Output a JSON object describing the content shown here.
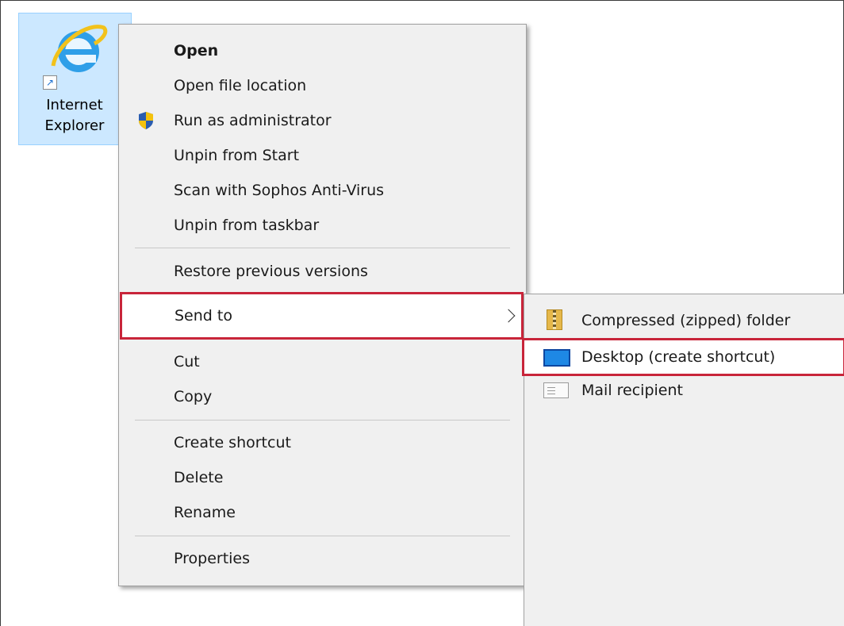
{
  "desktop_icon": {
    "label_line1": "Internet",
    "label_line2": "Explorer",
    "icon": "internet-explorer-icon"
  },
  "context_menu": {
    "items": [
      {
        "label": "Open"
      },
      {
        "label": "Open file location"
      },
      {
        "label": "Run as administrator",
        "icon": "shield-icon"
      },
      {
        "label": "Unpin from Start"
      },
      {
        "label": "Scan with Sophos Anti-Virus"
      },
      {
        "label": "Unpin from taskbar"
      },
      {
        "label": "Restore previous versions"
      },
      {
        "label": "Send to",
        "icon": "chevron-right-icon"
      },
      {
        "label": "Cut"
      },
      {
        "label": "Copy"
      },
      {
        "label": "Create shortcut"
      },
      {
        "label": "Delete"
      },
      {
        "label": "Rename"
      },
      {
        "label": "Properties"
      }
    ]
  },
  "send_to_submenu": {
    "items": [
      {
        "label": "Compressed (zipped) folder",
        "icon": "zip-folder-icon"
      },
      {
        "label": "Desktop (create shortcut)",
        "icon": "desktop-icon"
      },
      {
        "label": "Mail recipient",
        "icon": "mail-icon"
      }
    ]
  },
  "colors": {
    "highlight_border": "#c8253a",
    "menu_background": "#f0f0f0",
    "icon_selection": "#cce8ff"
  }
}
